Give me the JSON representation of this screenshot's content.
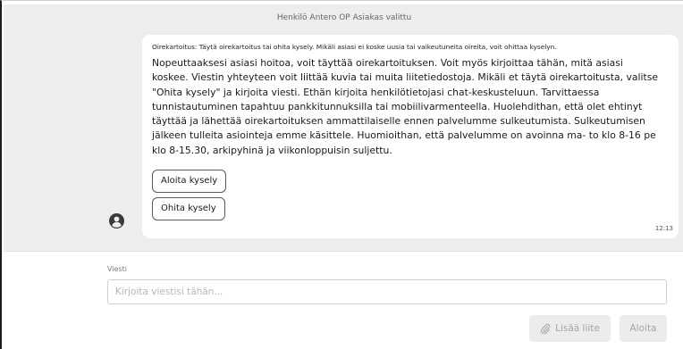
{
  "chat": {
    "system_note": "Henkilö Antero OP Asiakas valittu",
    "message": {
      "heading": "Oirekartoitus: Täytä oirekartoitus tai ohita kysely. Mikäli asiasi ei koske uusia tai vaikeutuneita oireita, voit ohittaa kyselyn.",
      "body": "Nopeuttaaksesi asiasi hoitoa, voit täyttää oirekartoituksen. Voit myös kirjoittaa tähän, mitä asiasi koskee. Viestin yhteyteen voit liittää kuvia tai muita liitetiedostoja. Mikäli et täytä oirekartoitusta, valitse \"Ohita kysely\" ja kirjoita viesti. Ethän kirjoita henkilötietojasi chat-keskusteluun. Tarvittaessa tunnistautuminen tapahtuu pankkitunnuksilla tai mobiilivarmenteella. Huolehdithan, että olet ehtinyt täyttää ja lähettää oirekartoituksen ammattilaiselle ennen palvelumme sulkeutumista. Sulkeutumisen jälkeen tulleita asiointeja emme käsittele. Huomioithan, että palvelumme on avoinna ma- to klo 8-16 pe klo 8-15.30, arkipyhinä ja viikonloppuisin suljettu.",
      "start_survey_label": "Aloita kysely",
      "skip_survey_label": "Ohita kysely",
      "time": "12:13",
      "avatar_icon": "user-circle-icon"
    }
  },
  "composer": {
    "label": "Viesti",
    "placeholder": "Kirjoita viestisi tähän...",
    "value": "",
    "attach_label": "Lisää liite",
    "attach_icon": "paperclip-icon",
    "send_label": "Aloita"
  },
  "colors": {
    "chat_background": "#ededed",
    "bubble_background": "#ffffff",
    "disabled_button": "#ececec",
    "disabled_text": "#a5a5a5"
  }
}
